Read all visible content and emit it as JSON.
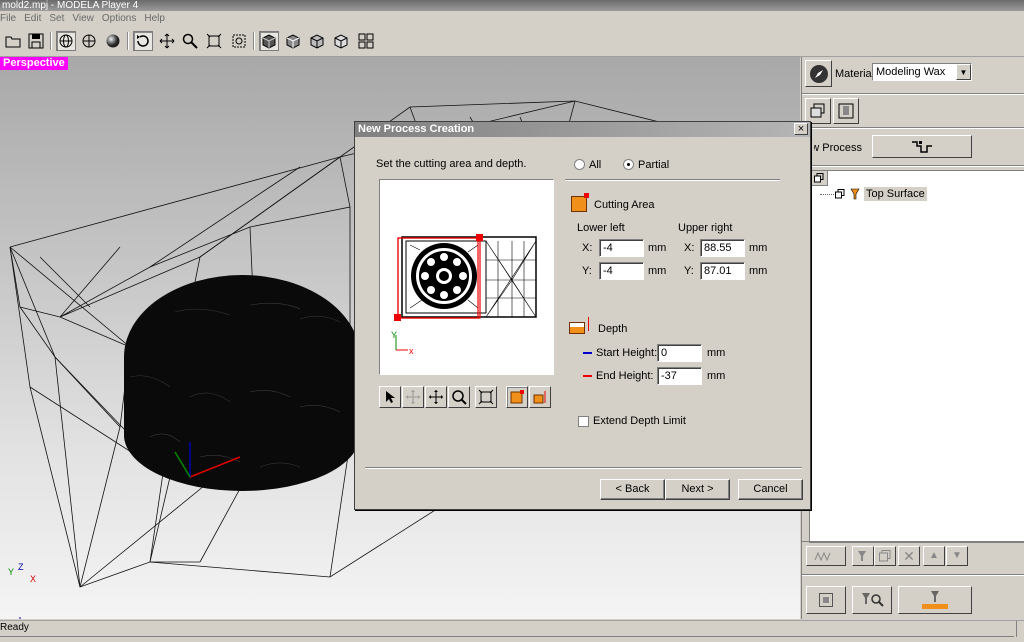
{
  "app": {
    "title": "mold2.mpj - MODELA Player 4"
  },
  "menu": [
    "File",
    "Edit",
    "Set",
    "View",
    "Options",
    "Help"
  ],
  "toolbar": {
    "icons": [
      "open-icon",
      "save-icon",
      "wireframe-icon",
      "globe-icon",
      "sphere-icon",
      "rotate-icon",
      "pan-icon",
      "zoom-icon",
      "fit-icon",
      "zoom-window-icon",
      "view-perspective-icon",
      "view-front-icon",
      "view-side-icon",
      "view-top-icon",
      "multi-view-icon"
    ]
  },
  "viewport": {
    "mode_label": "Perspective",
    "axis_labels": {
      "x": "X",
      "y": "Y",
      "z": "Z"
    }
  },
  "right_panel": {
    "material_label": "Material",
    "material_value": "Modeling Wax",
    "new_process_label": "New Process",
    "tree": {
      "item": "Top Surface"
    }
  },
  "status": {
    "text": "Ready"
  },
  "dialog": {
    "title": "New Process Creation",
    "close": "×",
    "instruction": "Set the cutting area and depth.",
    "radio_all": "All",
    "radio_partial": "Partial",
    "selected": "Partial",
    "cutting_area_label": "Cutting Area",
    "lower_left_label": "Lower left",
    "upper_right_label": "Upper right",
    "x_label": "X:",
    "y_label": "Y:",
    "unit": "mm",
    "lower_left": {
      "x": "-4",
      "y": "-4"
    },
    "upper_right": {
      "x": "88.55",
      "y": "87.01"
    },
    "depth_label": "Depth",
    "start_height_label": "Start Height:",
    "start_height": "0",
    "end_height_label": "End Height:",
    "end_height": "-37",
    "extend_depth_label": "Extend Depth Limit",
    "extend_depth_checked": false,
    "preview_axes": {
      "y": "Y",
      "x": "x"
    },
    "buttons": {
      "back": "< Back",
      "next": "Next >",
      "cancel": "Cancel"
    }
  }
}
